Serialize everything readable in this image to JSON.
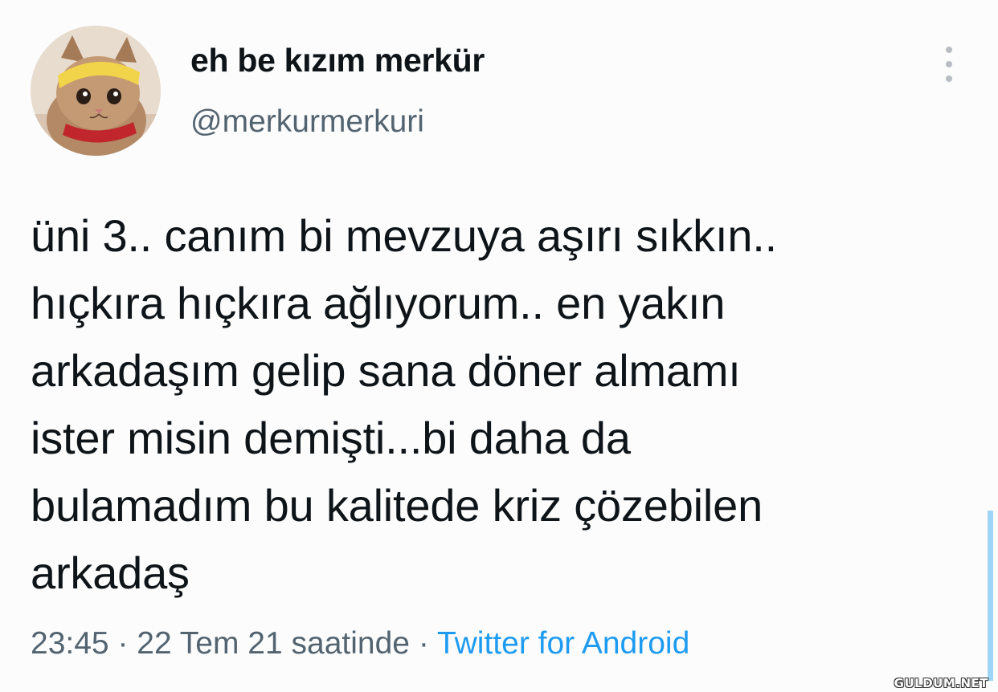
{
  "tweet": {
    "display_name": "eh be kızım merkür",
    "handle": "@merkurmerkuri",
    "text": "üni 3.. canım bi mevzuya aşırı sıkkın..\nhıçkıra hıçkıra ağlıyorum.. en yakın\narkadaşım gelip sana döner almamı\nister misin demişti...bi daha da\nbulamadım bu kalitede kriz çözebilen\narkadaş",
    "time": "23:45",
    "separator_1": " · ",
    "date": "22 Tem 21 saatinde",
    "separator_2": " · ",
    "source": "Twitter for Android",
    "more_icon": "more-vertical-icon"
  },
  "watermark": "GULDUM.NET",
  "colors": {
    "text": "#0f1419",
    "secondary": "#536471",
    "accent": "#1d9bf0"
  }
}
